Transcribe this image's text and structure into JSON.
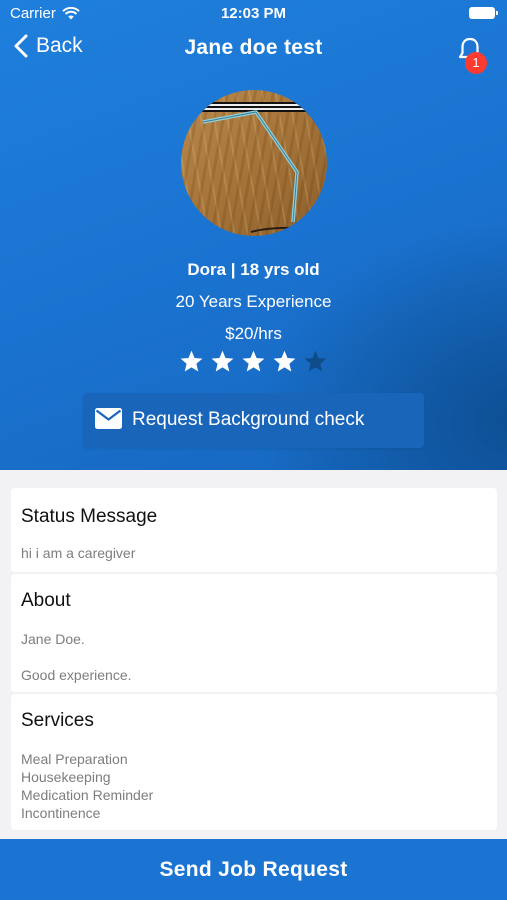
{
  "status_bar": {
    "carrier": "Carrier",
    "time": "12:03 PM"
  },
  "nav": {
    "back_label": "Back",
    "title": "Jane doe test",
    "notification_count": "1"
  },
  "profile": {
    "name_age": "Dora | 18 yrs old",
    "experience": "20 Years  Experience",
    "rate": "$20/hrs",
    "rating": 4,
    "rating_max": 5,
    "background_check_label": "Request Background check"
  },
  "sections": {
    "status": {
      "title": "Status Message",
      "text": "hi i am a caregiver"
    },
    "about": {
      "title": "About",
      "line1": "Jane Doe.",
      "line2": "Good experience."
    },
    "services": {
      "title": "Services",
      "items": [
        "Meal Preparation",
        "Housekeeping",
        "Medication Reminder",
        "Incontinence"
      ]
    }
  },
  "cta": {
    "label": "Send Job Request"
  },
  "colors": {
    "primary": "#1b74d1",
    "star_active": "#ffffff",
    "star_inactive": "#0f4d8a",
    "badge": "#ff3b30"
  }
}
